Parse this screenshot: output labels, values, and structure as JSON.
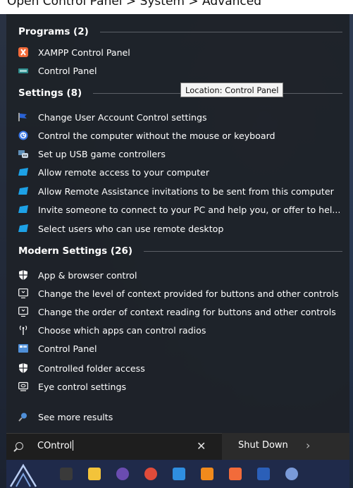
{
  "top_strip": {
    "text": "Open Control Panel > System > Advanced"
  },
  "sections": {
    "programs": {
      "title": "Programs (2)"
    },
    "settings": {
      "title": "Settings (8)"
    },
    "modern": {
      "title": "Modern Settings (26)"
    }
  },
  "programs": [
    {
      "label": "XAMPP Control Panel",
      "icon": "xampp-icon"
    },
    {
      "label": "Control Panel",
      "icon": "control-panel-icon"
    }
  ],
  "settings": [
    {
      "label": "Change User Account Control settings",
      "icon": "uac-flag-icon"
    },
    {
      "label": "Control the computer without the mouse or keyboard",
      "icon": "ease-of-access-icon"
    },
    {
      "label": "Set up USB game controllers",
      "icon": "game-controller-icon"
    },
    {
      "label": "Allow remote access to your computer",
      "icon": "remote-desktop-icon"
    },
    {
      "label": "Allow Remote Assistance invitations to be sent from this computer",
      "icon": "remote-desktop-icon"
    },
    {
      "label": "Invite someone to connect to your PC and help you, or offer to hel...",
      "icon": "remote-desktop-icon"
    },
    {
      "label": "Select users who can use remote desktop",
      "icon": "remote-desktop-icon"
    }
  ],
  "modern": [
    {
      "label": "App & browser control",
      "icon": "shield-icon"
    },
    {
      "label": "Change the level of context provided for buttons and other controls",
      "icon": "narrator-icon"
    },
    {
      "label": "Change the order of context reading for buttons and other controls",
      "icon": "narrator-icon"
    },
    {
      "label": "Choose which apps can control radios",
      "icon": "radio-icon"
    },
    {
      "label": "Control Panel",
      "icon": "control-panel-icon"
    },
    {
      "label": "Controlled folder access",
      "icon": "shield-icon"
    },
    {
      "label": "Eye control settings",
      "icon": "eye-control-icon"
    }
  ],
  "see_more": {
    "label": "See more results",
    "icon": "search-icon"
  },
  "tooltip": {
    "text": "Location: Control Panel"
  },
  "search": {
    "value": "COntrol"
  },
  "power": {
    "shut_down": "Shut Down",
    "arrow": "›"
  },
  "colors": {
    "panel": "#1e2229",
    "accent": "#0078d7",
    "taskbar": "#1f2a4a"
  }
}
